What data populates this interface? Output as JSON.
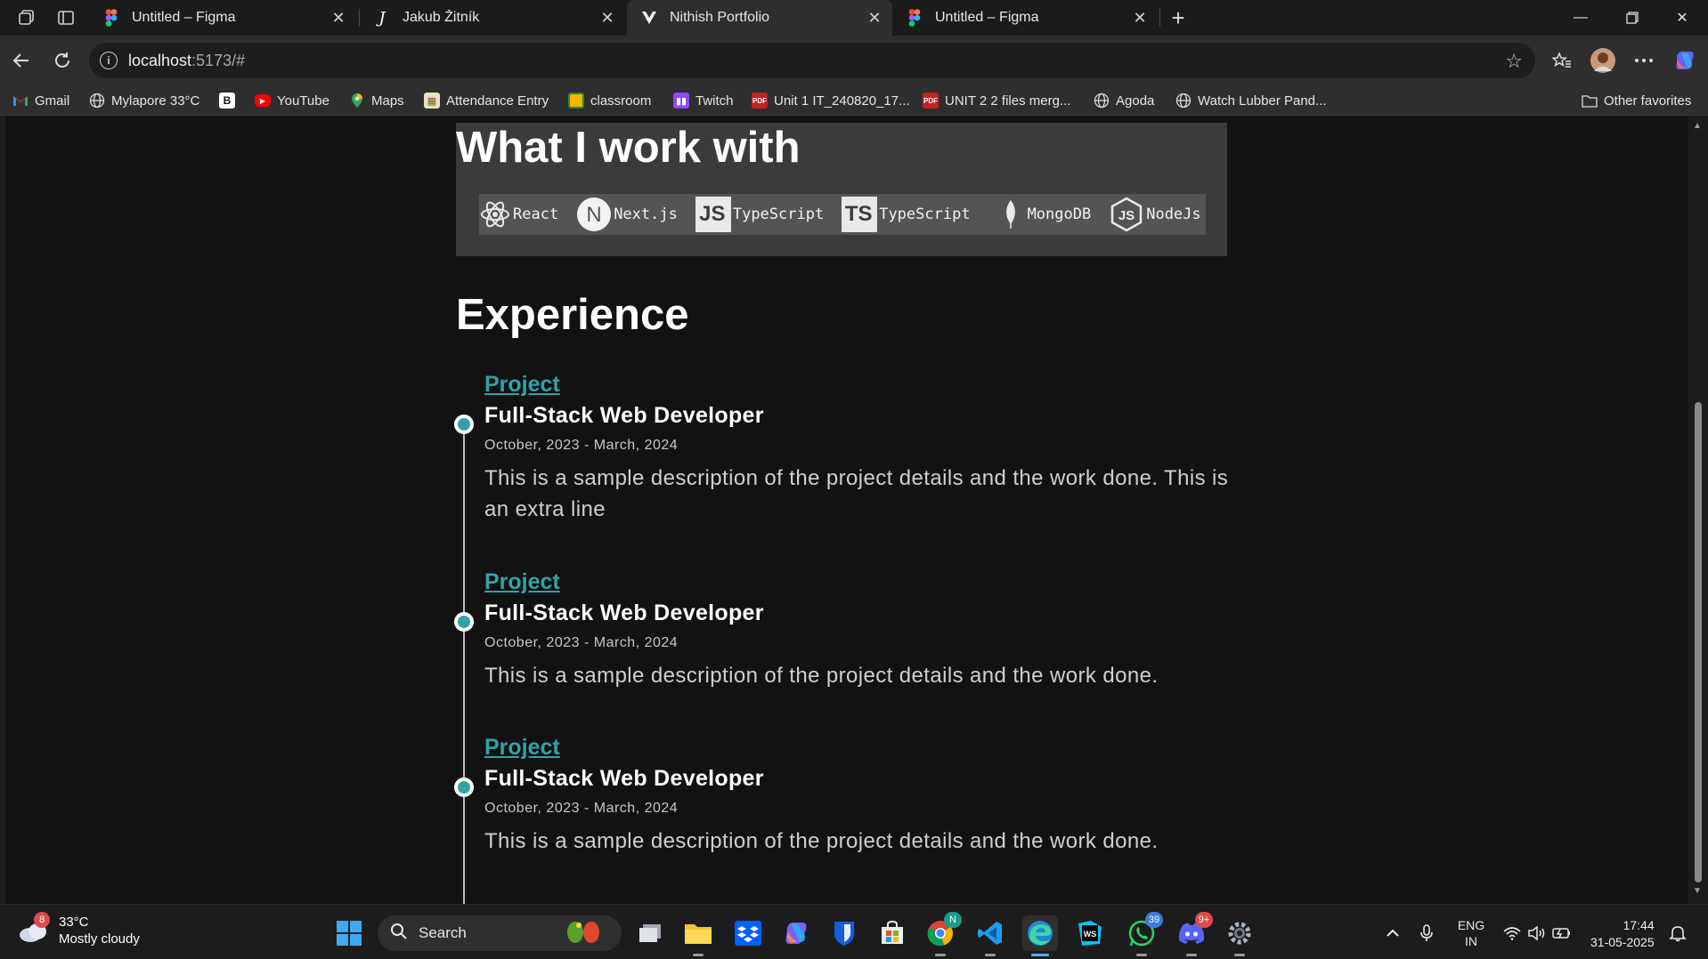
{
  "browser": {
    "tabs": [
      {
        "title": "Untitled – Figma",
        "icon": "figma-icon"
      },
      {
        "title": "Jakub Žitník",
        "icon": "j-logo-icon"
      },
      {
        "title": "Nithish Portfolio",
        "icon": "portfolio-v-icon",
        "active": true
      },
      {
        "title": "Untitled – Figma",
        "icon": "figma-icon"
      }
    ],
    "url_host": "localhost",
    "url_rest": ":5173/#",
    "bookmarks": [
      {
        "label": "Gmail",
        "icon": "gmail-icon"
      },
      {
        "label": "Mylapore 33°C",
        "icon": "globe-icon"
      },
      {
        "label": "",
        "icon": "b-icon"
      },
      {
        "label": "YouTube",
        "icon": "youtube-icon"
      },
      {
        "label": "Maps",
        "icon": "maps-icon"
      },
      {
        "label": "Attendance Entry",
        "icon": "site-icon"
      },
      {
        "label": "classroom",
        "icon": "classroom-icon"
      },
      {
        "label": "Twitch",
        "icon": "twitch-icon"
      },
      {
        "label": "Unit 1 IT_240820_17...",
        "icon": "pdf-icon"
      },
      {
        "label": "UNIT 2 2 files merg...",
        "icon": "pdf-icon"
      },
      {
        "label": "Agoda",
        "icon": "globe-icon"
      },
      {
        "label": "Watch Lubber Pand...",
        "icon": "globe-icon"
      }
    ],
    "other_favorites": "Other favorites"
  },
  "page": {
    "skills_heading": "What I work with",
    "skills": [
      {
        "label": "React",
        "icon": "react-icon"
      },
      {
        "label": "Next.js",
        "icon": "nextjs-icon"
      },
      {
        "label": "TypeScript",
        "icon": "js-badge-icon",
        "badge": "JS"
      },
      {
        "label": "TypeScript",
        "icon": "ts-badge-icon",
        "badge": "TS"
      },
      {
        "label": "MongoDB",
        "icon": "mongodb-leaf-icon"
      },
      {
        "label": "NodeJs",
        "icon": "nodejs-icon"
      }
    ],
    "experience_heading": "Experience",
    "experience": [
      {
        "project": "Project",
        "role": "Full-Stack Web Developer",
        "dates": "October, 2023 - March, 2024",
        "description": "This is a sample description of the project details and the work done. This is an extra line"
      },
      {
        "project": "Project",
        "role": "Full-Stack Web Developer",
        "dates": "October, 2023 - March, 2024",
        "description": "This is a sample description of the project details and the work done."
      },
      {
        "project": "Project",
        "role": "Full-Stack Web Developer",
        "dates": "October, 2023 - March, 2024",
        "description": "This is a sample description of the project details and the work done."
      }
    ],
    "accent_color": "#32a2a8"
  },
  "taskbar": {
    "weather_temp": "33°C",
    "weather_desc": "Mostly cloudy",
    "weather_badge": "8",
    "search_label": "Search",
    "apps": [
      {
        "name": "file-explorer-icon"
      },
      {
        "name": "dropbox-icon"
      },
      {
        "name": "copilot-icon"
      },
      {
        "name": "bitwarden-icon"
      },
      {
        "name": "store-icon"
      },
      {
        "name": "chrome-icon"
      },
      {
        "name": "vscode-icon"
      },
      {
        "name": "edge-icon",
        "active": true
      },
      {
        "name": "webstorm-icon"
      },
      {
        "name": "whatsapp-icon",
        "badge": "39"
      },
      {
        "name": "discord-icon",
        "badge": "9+"
      },
      {
        "name": "settings-icon"
      }
    ],
    "lang_line1": "ENG",
    "lang_line2": "IN",
    "time": "17:44",
    "date": "31-05-2025"
  }
}
